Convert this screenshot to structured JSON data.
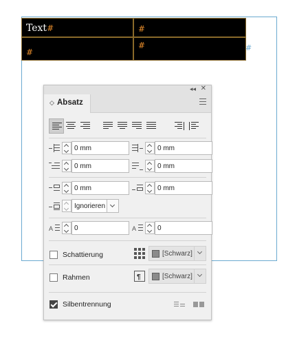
{
  "document": {
    "cell_text": "Text",
    "hash": "#",
    "overflow_marker": "#"
  },
  "panel": {
    "tab_label": "Absatz",
    "tab_arrows": "◇",
    "collapse_icon": "◂◂",
    "close_icon": "✕",
    "indent_left": "0 mm",
    "indent_right": "0 mm",
    "first_line_indent": "0 mm",
    "last_line_indent": "0 mm",
    "space_before": "0 mm",
    "space_after": "0 mm",
    "align_to_grid": "Ignorieren",
    "drop_cap_lines": "0",
    "drop_cap_chars": "0",
    "shading_label": "Schattierung",
    "shading_color": "[Schwarz]",
    "border_label": "Rahmen",
    "border_color": "[Schwarz]",
    "hyphenation_label": "Silbentrennung",
    "hyphenation_checked": true,
    "shading_checked": false,
    "border_checked": false,
    "swatch_color": "#8b8b8b"
  }
}
